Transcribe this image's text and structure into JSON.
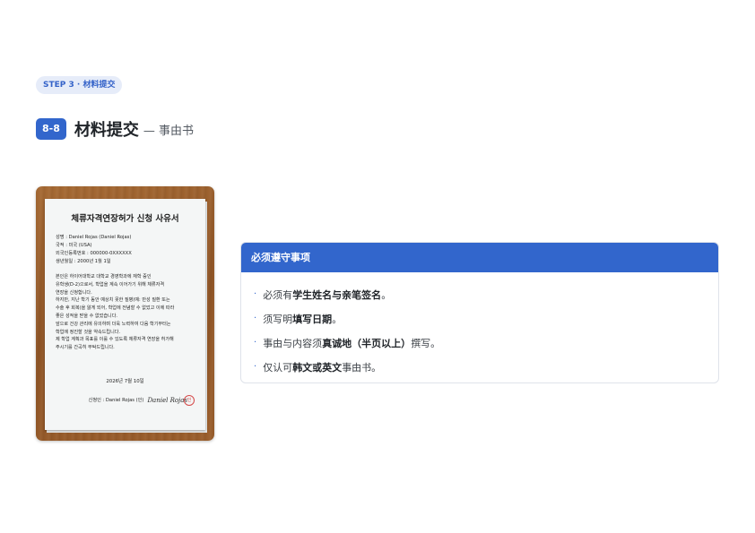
{
  "step_badge": "STEP 3 · 材料提交",
  "header": {
    "number": "8-8",
    "title": "材料提交",
    "subtitle": "— 事由书"
  },
  "document": {
    "title": "체류자격연장허가 신청 사유서",
    "info": [
      "성명 : Daniel Rojas (Daniel Rojas)",
      "국적 : 미국 (USA)",
      "외국인등록번호 : 000000-0XXXXXX",
      "생년월일 : 2000년 1월 1일"
    ],
    "body": [
      "본인은 하이어대학교 대학교 경영학과에 재학 중인",
      "유학생(D-2)으로서, 학업을 계속 이어가기 위해 체류자격",
      "연장을 신청합니다.",
      "하지만, 지난 학기 동안 예상치 못한 질병(예: 만성 질환 또는",
      "수술 후 회복)을 앓게 되어, 학업에 전념할 수 없었고 이에 따라",
      "좋은 성적을 받을 수 없었습니다.",
      "앞으로 건강 관리에 유의하며 더욱 노력하여 다음 학기부터는",
      "학업에 정진할 것을 약속드립니다.",
      "제 학업 계획과 목표를 이룰 수 있도록 체류자격 연장을 허가해",
      "주시기를 간곡히 부탁드립니다."
    ],
    "date": "2026년 7월 10일",
    "applicant": "신청인 : Daniel Rojas (인)",
    "signature": "Daniel Rojas",
    "stamp": "인"
  },
  "notice": {
    "heading": "必须遵守事项",
    "items": [
      {
        "pre": "必须有 ",
        "bold": "学生姓名与亲笔签名",
        "post": "。"
      },
      {
        "pre": "须写明 ",
        "bold": "填写日期",
        "post": "。"
      },
      {
        "pre": "事由与内容须 ",
        "bold": "真诚地（半页以上）",
        "post": " 撰写。"
      },
      {
        "pre": "仅认可 ",
        "bold": "韩文或英文",
        "post": " 事由书。"
      }
    ],
    "bullet": "·"
  },
  "colors": {
    "accent": "#3266cc",
    "badge_bg": "#e6ecf9",
    "wood": "#9a5e2c"
  }
}
